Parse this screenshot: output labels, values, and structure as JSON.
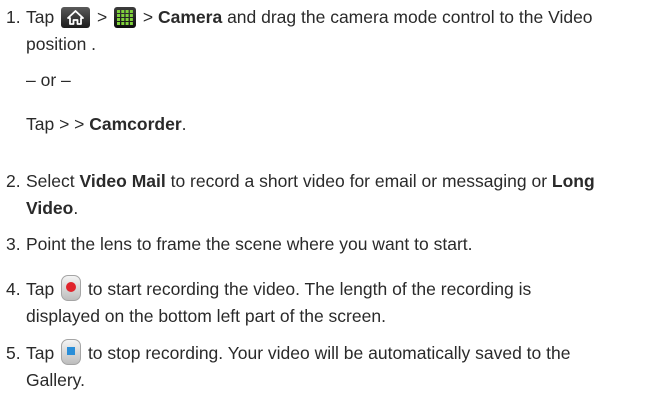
{
  "steps": {
    "s1": {
      "num": "1.",
      "t1": "Tap ",
      "sep1": " > ",
      "sep2": " > ",
      "camera": "Camera",
      "t2": " and drag the camera mode control to the Video",
      "t3": "position .",
      "or": "– or –",
      "alt1": "Tap > > ",
      "camcorder": "Camcorder",
      "alt2": "."
    },
    "s2": {
      "num": "2.",
      "t1": "Select ",
      "video_mail": "Video Mail",
      "t2": " to record a short video for email or messaging or ",
      "long": "Long",
      "video": "Video",
      "t3": "."
    },
    "s3": {
      "num": "3.",
      "t1": "Point the lens to frame the scene where you want to start."
    },
    "s4": {
      "num": "4.",
      "t1": "Tap ",
      "t2": " to start recording the video. The length of the recording is",
      "t3": "displayed on the bottom left part of the screen."
    },
    "s5": {
      "num": "5.",
      "t1": "Tap ",
      "t2": " to stop recording. Your video will be automatically saved to the",
      "t3": "Gallery."
    }
  },
  "icons": {
    "home": "home-icon",
    "apps": "apps-grid-icon",
    "record": "record-button-icon",
    "stop": "stop-button-icon"
  }
}
